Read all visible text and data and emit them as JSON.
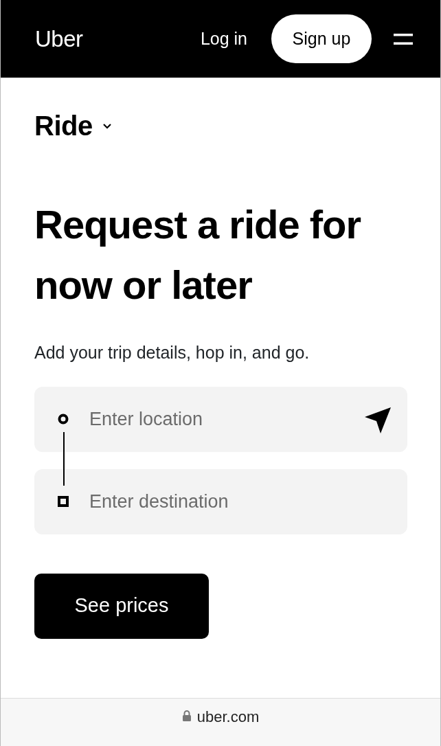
{
  "header": {
    "logo": "Uber",
    "login": "Log in",
    "signup": "Sign up"
  },
  "product": {
    "label": "Ride"
  },
  "heading": "Request a ride for now or later",
  "subtitle": "Add your trip details, hop in, and go.",
  "fields": [
    {
      "kind": "pickup",
      "placeholder": "Enter location"
    },
    {
      "kind": "dropoff",
      "placeholder": "Enter destination"
    }
  ],
  "button": "See prices",
  "address_bar": {
    "url": "uber.com"
  }
}
